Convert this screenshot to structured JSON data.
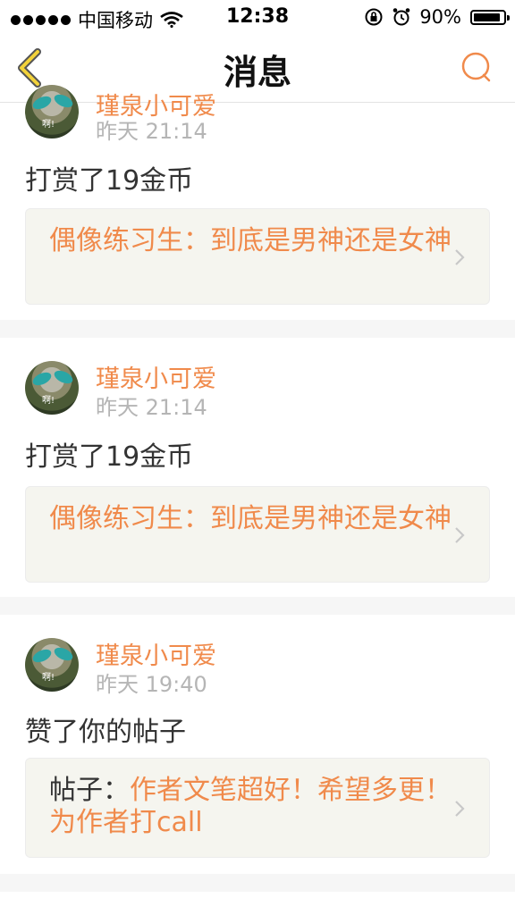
{
  "status_bar": {
    "carrier": "中国移动",
    "time": "12:38",
    "battery": "90%",
    "battery_level": 0.9
  },
  "nav": {
    "title": "消息"
  },
  "messages": [
    {
      "user": "瑾泉小可爱",
      "time": "昨天 21:14",
      "action": "打赏了19金币",
      "ref_prefix": "",
      "ref_text": "偶像练习生：到底是男神还是女神",
      "avatar_caption": "啊!"
    },
    {
      "user": "瑾泉小可爱",
      "time": "昨天 21:14",
      "action": "打赏了19金币",
      "ref_prefix": "",
      "ref_text": "偶像练习生：到底是男神还是女神",
      "avatar_caption": "啊!"
    },
    {
      "user": "瑾泉小可爱",
      "time": "昨天 19:40",
      "action": "赞了你的帖子",
      "ref_prefix": "帖子：",
      "ref_text": "作者文笔超好！希望多更！为作者打call",
      "avatar_caption": "啊!"
    }
  ]
}
